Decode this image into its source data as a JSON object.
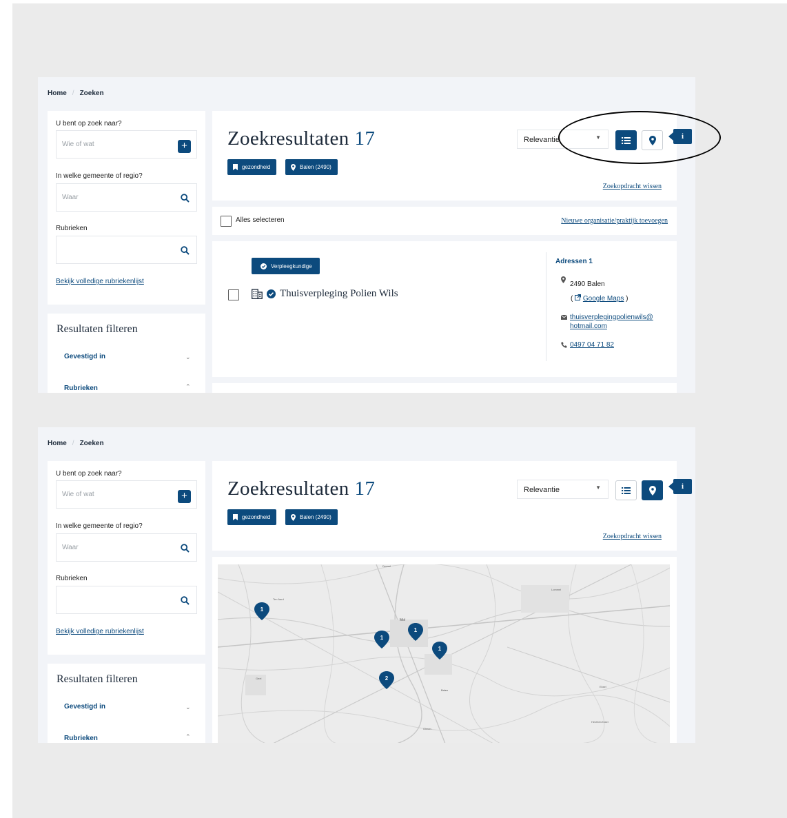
{
  "breadcrumb": {
    "home": "Home",
    "current": "Zoeken"
  },
  "search": {
    "what_label": "U bent op zoek naar?",
    "what_placeholder": "Wie of wat",
    "where_label": "In welke gemeente of regio?",
    "where_placeholder": "Waar",
    "rubrics_label": "Rubrieken",
    "rubrics_placeholder": "",
    "full_list_link": "Bekijk volledige rubriekenlijst"
  },
  "filters": {
    "title": "Resultaten filteren",
    "items": [
      {
        "label": "Gevestigd in",
        "state": "collapsed"
      },
      {
        "label": "Rubrieken",
        "state": "expanded"
      }
    ]
  },
  "results": {
    "title": "Zoekresultaten",
    "count": "17",
    "tags": [
      {
        "label": "gezondheid",
        "icon": "bookmark-icon"
      },
      {
        "label": "Balen (2490)",
        "icon": "location-pin-icon"
      }
    ],
    "sort_value": "Relevantie",
    "clear_link": "Zoekopdracht wissen",
    "select_all": "Alles selecteren",
    "new_org_link": "Nieuwe organisatie/praktijk toevoegen",
    "info_label": "i"
  },
  "result_item": {
    "category": "Verpleegkundige",
    "name": "Thuisverpleging Polien Wils",
    "addresses_title": "Adressen 1",
    "address": "2490 Balen",
    "google_maps": "Google Maps",
    "email_line1": "thuisverplegingpolienwils@",
    "email_line2": "hotmail.com",
    "phone": "0497 04 71 82"
  },
  "map": {
    "places": [
      "Dessel",
      "Ten Aard",
      "Mol",
      "Lommel",
      "Geel",
      "Balen",
      "Olmen",
      "Eksel",
      "Hechtel-Eksel"
    ],
    "markers": [
      "1",
      "1",
      "1",
      "1",
      "2"
    ]
  },
  "colors": {
    "brand": "#0c4a7d",
    "page_bg": "#ebebeb",
    "panel_bg": "#f2f4f8"
  }
}
